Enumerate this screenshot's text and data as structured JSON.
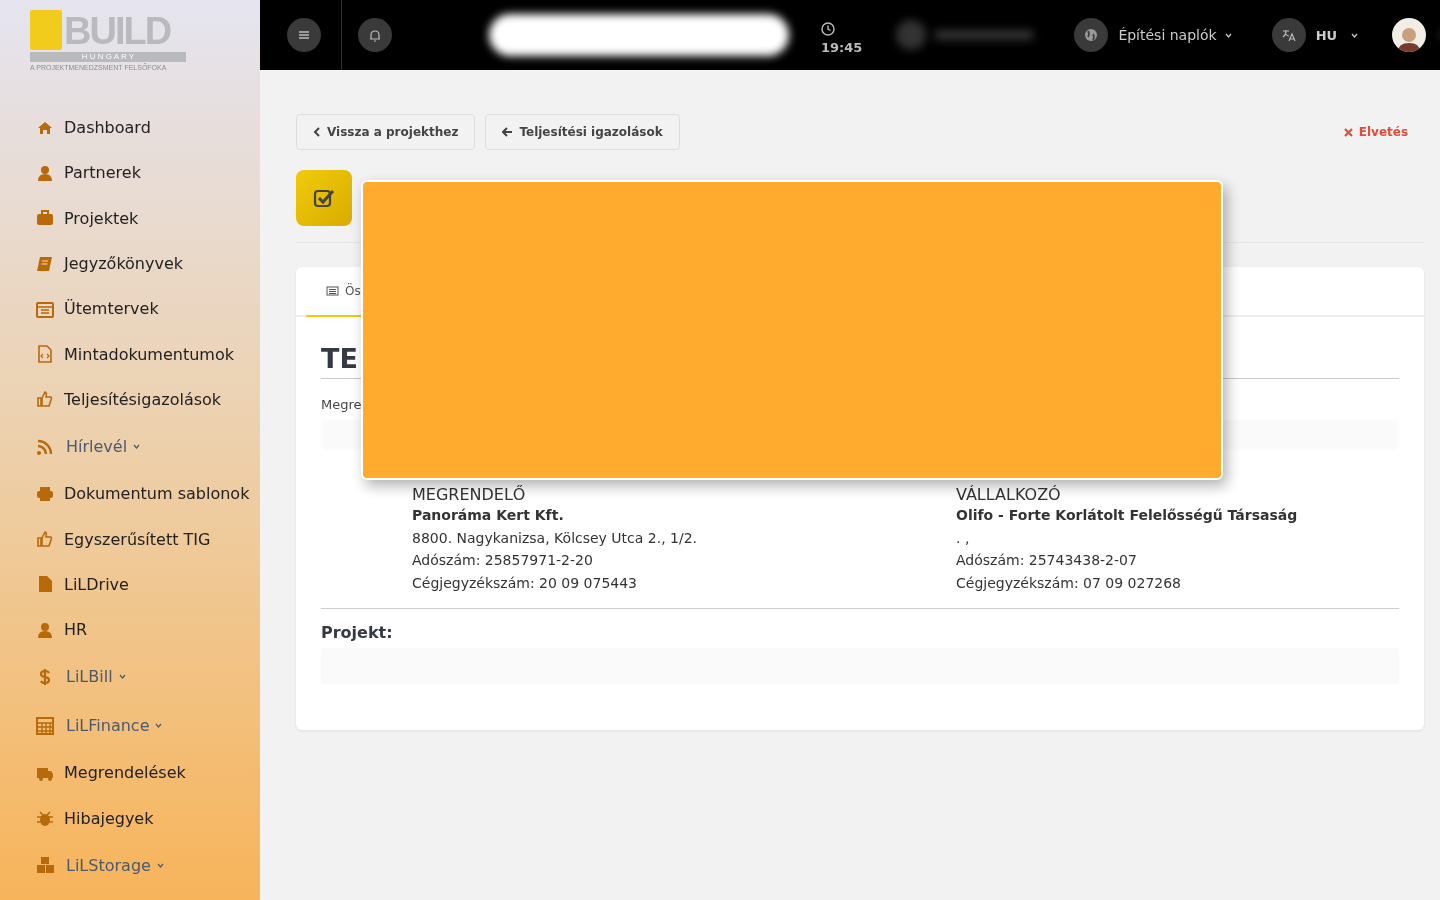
{
  "sidebar": {
    "logo": {
      "word": "BUILD",
      "country": "H U N G A R Y",
      "tagline": "A PROJEKTMENEDZSMENT FELSŐFOKA"
    },
    "items": [
      {
        "label": "Dashboard",
        "kind": "link"
      },
      {
        "label": "Partnerek",
        "kind": "link"
      },
      {
        "label": "Projektek",
        "kind": "link"
      },
      {
        "label": "Jegyzőkönyvek",
        "kind": "link"
      },
      {
        "label": "Ütemtervek",
        "kind": "link"
      },
      {
        "label": "Mintadokumentumok",
        "kind": "link"
      },
      {
        "label": "Teljesítésigazolások",
        "kind": "link"
      },
      {
        "label": "Hírlevél",
        "kind": "dropdown"
      },
      {
        "label": "Dokumentum sablonok",
        "kind": "link"
      },
      {
        "label": "Egyszerűsített TIG",
        "kind": "link"
      },
      {
        "label": "LiLDrive",
        "kind": "link"
      },
      {
        "label": "HR",
        "kind": "link"
      },
      {
        "label": "LiLBill",
        "kind": "dropdown"
      },
      {
        "label": "LiLFinance",
        "kind": "dropdown"
      },
      {
        "label": "Megrendelések",
        "kind": "link"
      },
      {
        "label": "Hibajegyek",
        "kind": "link"
      },
      {
        "label": "LiLStorage",
        "kind": "dropdown"
      }
    ]
  },
  "topbar": {
    "time": "19:45",
    "diary_menu": "Építési naplók",
    "language": "HU"
  },
  "toolbar": {
    "back_button": "Vissza a projekthez",
    "list_button": "Teljesítési igazolások",
    "discard_button": "Elvetés"
  },
  "card": {
    "tabs": [
      {
        "label": "Ös",
        "selected": true
      }
    ],
    "title": "TE",
    "field_label": "Megre",
    "parties": [
      {
        "heading": "MEGRENDELŐ",
        "name": "Panoráma Kert Kft.",
        "address": "8800. Nagykanizsa, Kölcsey Utca 2., 1/2.",
        "tax": "Adószám: 25857971-2-20",
        "registry": "Cégjegyzékszám: 20 09 075443"
      },
      {
        "heading": "VÁLLALKOZÓ",
        "name": "Olifo - Forte Korlátolt Felelősségű Társaság",
        "address": ". ,",
        "tax": "Adószám: 25743438-2-07",
        "registry": "Cégjegyzékszám: 07 09 027268"
      }
    ],
    "project_label": "Projekt:"
  }
}
